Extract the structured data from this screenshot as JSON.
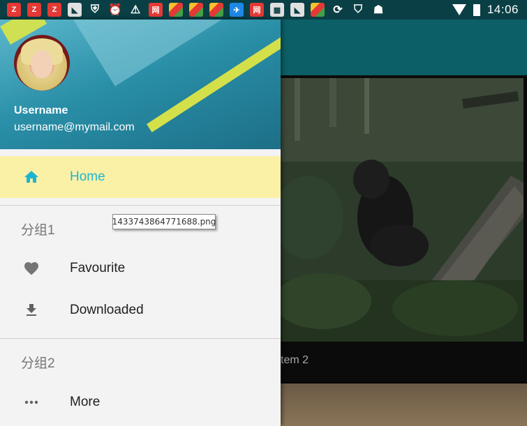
{
  "status_bar": {
    "time": "14:06",
    "left_icons": [
      {
        "name": "zhihu-z-icon",
        "style": "red",
        "glyph": "Z"
      },
      {
        "name": "zhihu-z-icon",
        "style": "red",
        "glyph": "Z"
      },
      {
        "name": "zhihu-z-icon",
        "style": "red",
        "glyph": "Z"
      },
      {
        "name": "app-icon",
        "style": "gray",
        "glyph": "◣"
      },
      {
        "name": "shield-icon",
        "style": "tri",
        "glyph": "⛨"
      },
      {
        "name": "alarm-icon",
        "style": "tri",
        "glyph": "⏰"
      },
      {
        "name": "warning-icon",
        "style": "tri",
        "glyph": "⚠"
      },
      {
        "name": "news-icon",
        "style": "red",
        "glyph": "网"
      },
      {
        "name": "chrome-icon",
        "style": "multi",
        "glyph": ""
      },
      {
        "name": "chrome-icon",
        "style": "multi",
        "glyph": ""
      },
      {
        "name": "chrome-icon",
        "style": "multi",
        "glyph": ""
      },
      {
        "name": "bird-icon",
        "style": "blue",
        "glyph": "✈"
      },
      {
        "name": "news-icon",
        "style": "red",
        "glyph": "网"
      },
      {
        "name": "app-icon",
        "style": "gray",
        "glyph": "▦"
      },
      {
        "name": "app-icon",
        "style": "gray",
        "glyph": "◣"
      },
      {
        "name": "chrome-icon",
        "style": "multi",
        "glyph": ""
      },
      {
        "name": "sync-icon",
        "style": "tri",
        "glyph": "⟳"
      },
      {
        "name": "security-icon",
        "style": "tri",
        "glyph": "⛉"
      },
      {
        "name": "android-icon",
        "style": "tri",
        "glyph": "☗"
      }
    ]
  },
  "drawer": {
    "header": {
      "username": "Username",
      "email": "username@mymail.com"
    },
    "home_label": "Home",
    "group1_title": "分组1",
    "favourite_label": "Favourite",
    "downloaded_label": "Downloaded",
    "group2_title": "分组2",
    "more_label": "More"
  },
  "tooltip": "1433743864771688.png",
  "content": {
    "card_caption": "tem 2"
  },
  "colors": {
    "active_bg": "#fbf1a6",
    "active_text": "#1fb5d1",
    "appbar": "#0c5f66",
    "statusbar": "#0a3f45"
  }
}
